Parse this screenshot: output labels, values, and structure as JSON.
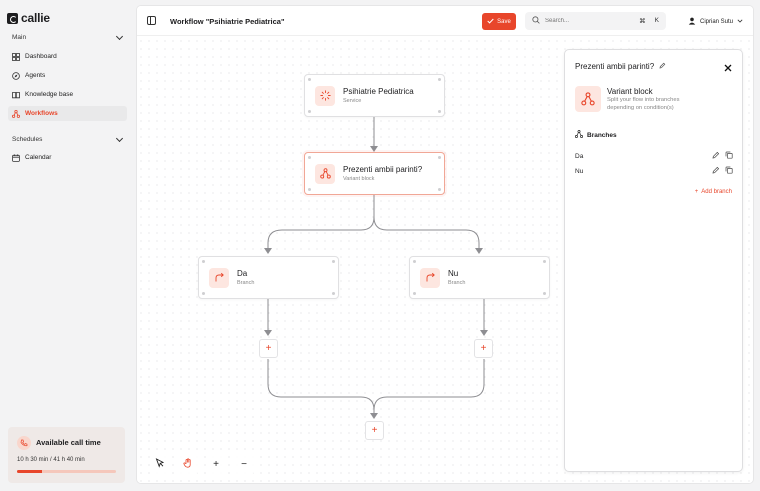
{
  "app": {
    "name": "callie"
  },
  "sidebar": {
    "main_label": "Main",
    "items": [
      {
        "label": "Dashboard",
        "icon": "grid-icon"
      },
      {
        "label": "Agents",
        "icon": "compass-icon"
      },
      {
        "label": "Knowledge base",
        "icon": "book-icon"
      },
      {
        "label": "Workflows",
        "icon": "workflow-icon",
        "active": true
      }
    ],
    "schedules_label": "Schedules",
    "schedule_items": [
      {
        "label": "Calendar",
        "icon": "calendar-icon"
      }
    ],
    "call_time": {
      "title": "Available call time",
      "usage": "10 h 30 min / 41 h 40 min",
      "progress": 0.25
    }
  },
  "header": {
    "title": "Workflow \"Psihiatrie Pediatrica\"",
    "save_label": "Save",
    "search_placeholder": "Search...",
    "shortcut_mod": "⌘",
    "shortcut_key": "K",
    "user_name": "Ciprian Sutu"
  },
  "nodes": {
    "service": {
      "title": "Psihiatrie Pediatrica",
      "subtitle": "Service"
    },
    "variant": {
      "title": "Prezenti ambii parinti?",
      "subtitle": "Variant block"
    },
    "branch_da": {
      "title": "Da",
      "subtitle": "Branch"
    },
    "branch_nu": {
      "title": "Nu",
      "subtitle": "Branch"
    }
  },
  "panel": {
    "title": "Prezenti ambii parinti?",
    "block_name": "Variant block",
    "block_description": "Split your flow into branches depending on condition(s)",
    "branches_label": "Branches",
    "branches": [
      "Da",
      "Nu"
    ],
    "add_branch_label": "Add branch"
  },
  "colors": {
    "accent": "#e8462b",
    "accent_soft": "#fde6e0"
  }
}
